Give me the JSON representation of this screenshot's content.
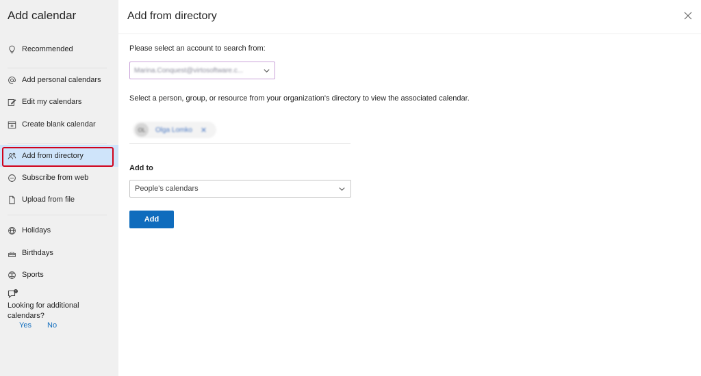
{
  "sidebar": {
    "title": "Add calendar",
    "items": [
      {
        "label": "Recommended",
        "icon": "lightbulb-icon"
      },
      {
        "label": "Add personal calendars",
        "icon": "at-icon"
      },
      {
        "label": "Edit my calendars",
        "icon": "edit-icon"
      },
      {
        "label": "Create blank calendar",
        "icon": "calendar-add-icon"
      },
      {
        "label": "Add from directory",
        "icon": "people-icon"
      },
      {
        "label": "Subscribe from web",
        "icon": "link-icon"
      },
      {
        "label": "Upload from file",
        "icon": "document-icon"
      },
      {
        "label": "Holidays",
        "icon": "globe-icon"
      },
      {
        "label": "Birthdays",
        "icon": "cake-icon"
      },
      {
        "label": "Sports",
        "icon": "ball-icon"
      }
    ],
    "feedback": {
      "text": "Looking for additional calendars?",
      "yes": "Yes",
      "no": "No"
    }
  },
  "main": {
    "title": "Add from directory",
    "account_prompt": "Please select an account to search from:",
    "account_value": "Marina.Conquest@virtosoftware.c...",
    "directory_prompt": "Select a person, group, or resource from your organization's directory to view the associated calendar.",
    "chip": {
      "initials": "OL",
      "name": "Olga Lomko",
      "remove": "✕"
    },
    "add_to_label": "Add to",
    "add_to_value": "People's calendars",
    "add_button": "Add"
  },
  "colors": {
    "accent": "#0f6cbd",
    "active_bg": "#cfe4fa",
    "highlight_outline": "#d0021b",
    "sidebar_bg": "#f0f0f0"
  }
}
